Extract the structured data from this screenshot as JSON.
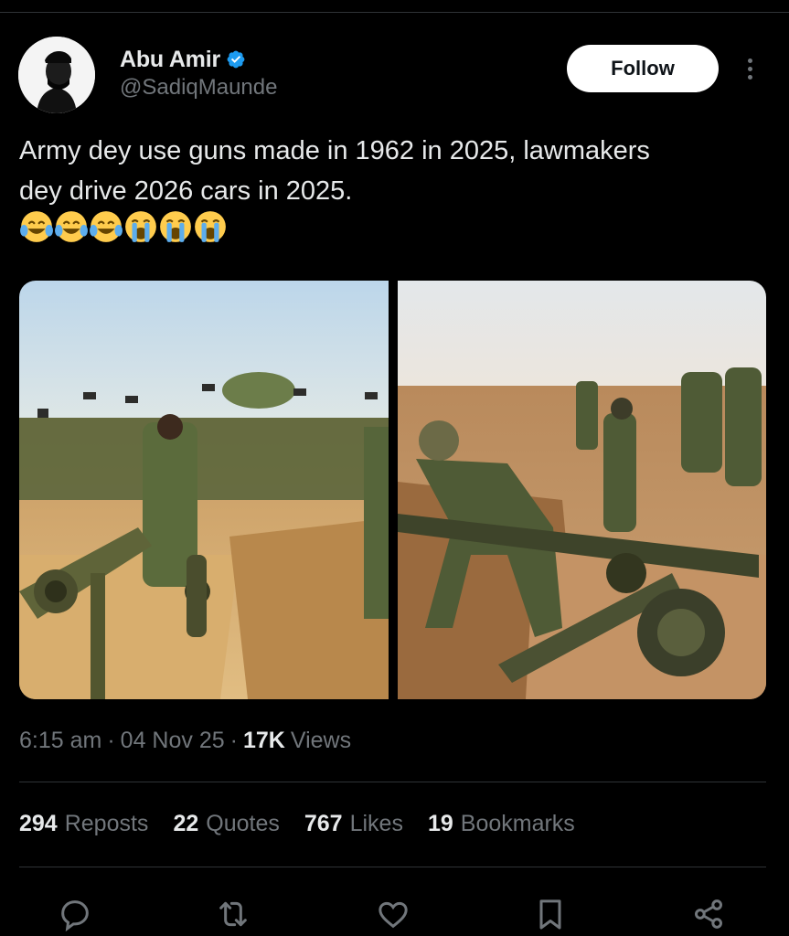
{
  "user": {
    "display_name": "Abu Amir",
    "handle": "@SadiqMaunde",
    "verified": true
  },
  "header": {
    "follow_label": "Follow"
  },
  "tweet": {
    "text_line1": "Army dey use guns made in 1962 in 2025, lawmakers",
    "text_line2": "dey drive 2026 cars in 2025.",
    "emojis": [
      "tears-of-joy",
      "tears-of-joy",
      "tears-of-joy",
      "loudly-crying",
      "loudly-crying",
      "loudly-crying"
    ]
  },
  "meta": {
    "time": "6:15 am",
    "date": "04 Nov 25",
    "views_count": "17K",
    "views_label": "Views",
    "separator": "·"
  },
  "stats": [
    {
      "count": "294",
      "label": "Reposts"
    },
    {
      "count": "22",
      "label": "Quotes"
    },
    {
      "count": "767",
      "label": "Likes"
    },
    {
      "count": "19",
      "label": "Bookmarks"
    }
  ],
  "actions": [
    "reply-icon",
    "repost-icon",
    "like-icon",
    "bookmark-icon",
    "share-icon"
  ],
  "colors": {
    "background": "#000000",
    "primary_text": "#e7e9ea",
    "secondary_text": "#71767b",
    "verified_blue": "#1d9bf0",
    "follow_bg": "#ffffff",
    "divider": "#2f3336"
  }
}
